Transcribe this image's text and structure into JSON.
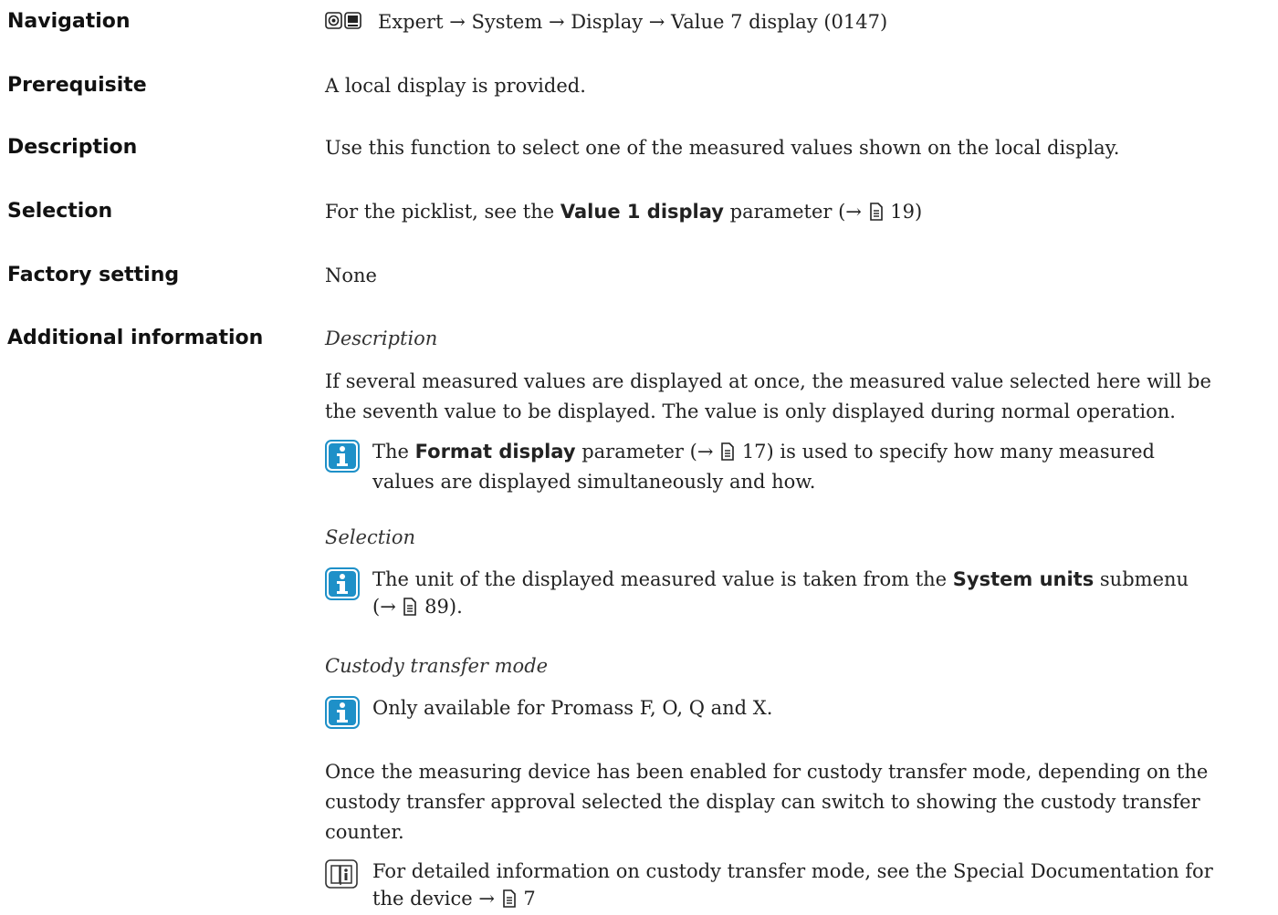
{
  "navigation": {
    "label": "Navigation",
    "path": "Expert → System → Display → Value 7 display (0147)"
  },
  "prerequisite": {
    "label": "Prerequisite",
    "text": "A local display is provided."
  },
  "description": {
    "label": "Description",
    "text": "Use this function to select one of the measured values shown on the local display."
  },
  "selection": {
    "label": "Selection",
    "text_before": "For the picklist, see the",
    "bold": "Value 1 display",
    "text_after": "parameter (→",
    "page": "19)"
  },
  "factory_setting": {
    "label": "Factory setting",
    "value": "None"
  },
  "additional_information": {
    "label": "Additional information",
    "desc_heading": "Description",
    "desc_line1": "If several measured values are displayed at once, the measured value selected here will be",
    "desc_line2": "the seventh value to be displayed. The value is only displayed during normal operation.",
    "note1": {
      "before": "The",
      "bold": "Format display",
      "after": "parameter (→",
      "page": "17) is used to specify how many measured",
      "line2": "values are displayed simultaneously and how."
    },
    "selection_heading": "Selection",
    "note2": {
      "before": "The unit of the displayed measured value is taken from the",
      "bold": "System units",
      "after": "submenu",
      "line2_before": "(→",
      "line2_page": "89)."
    },
    "custody_heading": "Custody transfer mode",
    "note3": "Only available for Promass F, O, Q and X.",
    "custody_line1": "Once the measuring device has been enabled for custody transfer mode, depending on the",
    "custody_line2": "custody transfer approval selected the display can switch to showing the custody transfer",
    "custody_line3": "counter.",
    "note4": {
      "line1": "For detailed information on custody transfer mode, see the Special Documentation for",
      "line2_before": "the device →",
      "line2_page": "7"
    }
  },
  "icons": {
    "info": "info-icon",
    "book": "book-icon",
    "page_ref": "page-reference-icon",
    "display_nav": "display-navigation-icon"
  },
  "colors": {
    "info_icon": "#1e90c8"
  }
}
